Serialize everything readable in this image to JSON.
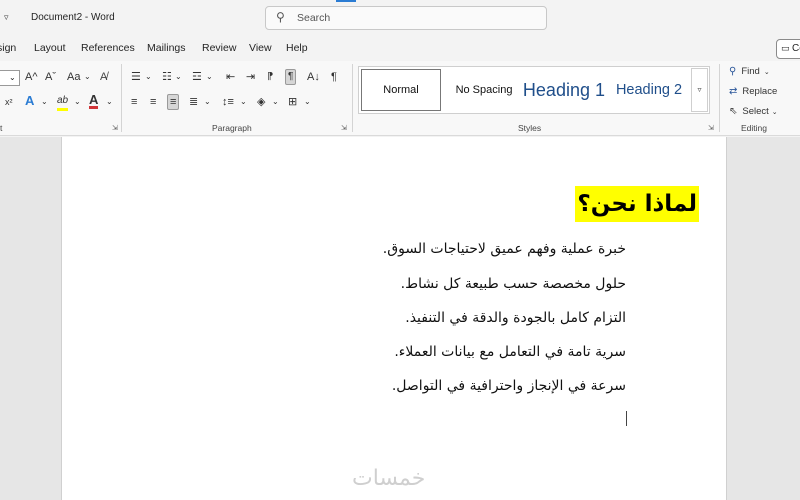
{
  "app": {
    "title": "Document2  -  Word",
    "search_placeholder": "Search",
    "comments_label": "Co"
  },
  "menu": {
    "items": [
      "sign",
      "Layout",
      "References",
      "Mailings",
      "Review",
      "View",
      "Help"
    ]
  },
  "ribbon": {
    "font": {
      "grow_label": "A^",
      "shrink_label": "Aˇ",
      "case_label": "Aa",
      "superscript_label": "x²",
      "text_effects_label": "A",
      "highlight_label": "ab",
      "font_color_label": "A"
    },
    "paragraph": {
      "label": "Paragraph",
      "sort_label": "A↓",
      "pilcrow_label": "¶"
    },
    "styles": {
      "label": "Styles",
      "items": [
        "Normal",
        "No Spacing",
        "Heading 1",
        "Heading 2"
      ]
    },
    "editing": {
      "label": "Editing",
      "find_label": "Find",
      "replace_label": "Replace",
      "select_label": "Select"
    },
    "font_group_label": "t",
    "colors": {
      "highlight": "#ffff00",
      "font_color": "#d13438",
      "text_effects": "#2b7cd3"
    }
  },
  "document": {
    "heading": "لماذا نحن؟",
    "lines": [
      "خبرة عملية وفهم عميق لاحتياجات السوق.",
      "حلول مخصصة حسب طبيعة كل نشاط.",
      "التزام كامل بالجودة والدقة في التنفيذ.",
      "سرية تامة في التعامل مع بيانات العملاء.",
      "سرعة في الإنجاز واحترافية في التواصل."
    ],
    "heading_highlight": "#ffff00"
  },
  "watermark": "خمسات"
}
